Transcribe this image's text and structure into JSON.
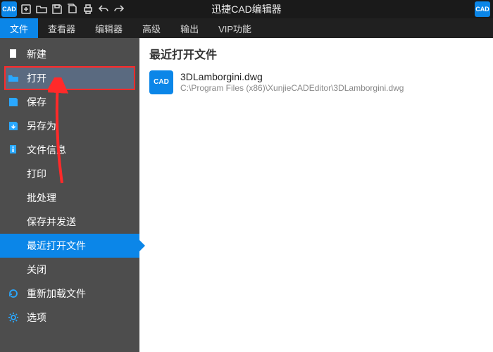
{
  "app": {
    "title": "迅捷CAD编辑器",
    "app_icon_text": "CAD"
  },
  "menubar": {
    "tabs": [
      {
        "label": "文件",
        "active": true
      },
      {
        "label": "查看器"
      },
      {
        "label": "编辑器"
      },
      {
        "label": "高级"
      },
      {
        "label": "输出"
      },
      {
        "label": "VIP功能"
      }
    ]
  },
  "sidebar": {
    "items": [
      {
        "id": "new",
        "label": "新建"
      },
      {
        "id": "open",
        "label": "打开",
        "highlight": true
      },
      {
        "id": "save",
        "label": "保存"
      },
      {
        "id": "saveas",
        "label": "另存为"
      },
      {
        "id": "fileinfo",
        "label": "文件信息"
      },
      {
        "id": "print",
        "label": "打印"
      },
      {
        "id": "batch",
        "label": "批处理"
      },
      {
        "id": "savesend",
        "label": "保存并发送"
      },
      {
        "id": "recent",
        "label": "最近打开文件",
        "selected": true
      },
      {
        "id": "close",
        "label": "关闭"
      },
      {
        "id": "reload",
        "label": "重新加载文件"
      },
      {
        "id": "options",
        "label": "选项"
      }
    ]
  },
  "content": {
    "header": "最近打开文件",
    "recent": [
      {
        "name": "3DLamborgini.dwg",
        "path": "C:\\Program Files (x86)\\XunjieCADEditor\\3DLamborgini.dwg"
      }
    ]
  }
}
